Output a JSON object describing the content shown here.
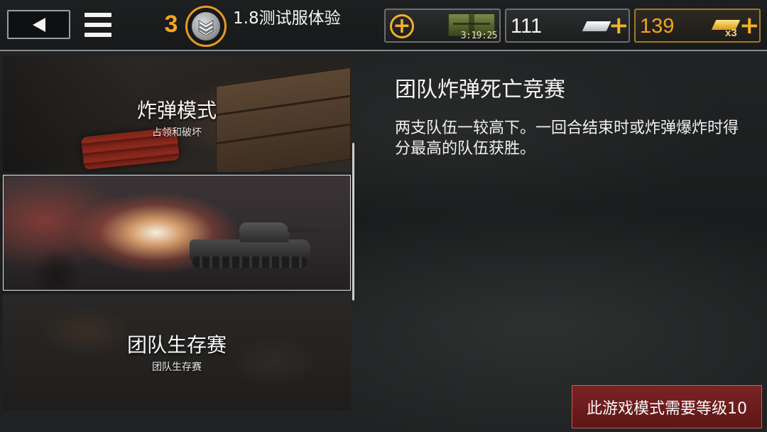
{
  "header": {
    "rank_level": "3",
    "server_label": "1.8测试服体验",
    "crate_timer": "3:19:25",
    "silver_amount": "111",
    "gold_amount": "139",
    "gold_multiplier": "x3",
    "accent_color": "#f0b12c"
  },
  "modes": [
    {
      "title": "炸弹模式",
      "subtitle": "占领和破坏",
      "selected": false
    },
    {
      "title": "",
      "subtitle": "",
      "selected": true
    },
    {
      "title": "团队生存赛",
      "subtitle": "团队生存赛",
      "selected": false
    }
  ],
  "detail": {
    "title": "团队炸弹死亡竞赛",
    "description": "两支队伍一较高下。一回合结束时或炸弹爆炸时得分最高的队伍获胜。",
    "requirement": "此游戏模式需要等级10",
    "requirement_color": "#7b2323"
  },
  "icons": [
    "back-arrow-icon",
    "hamburger-menu-icon",
    "rank-chevron-icon",
    "add-circle-icon",
    "ammo-crate-icon",
    "silver-bar-icon",
    "gold-bar-icon",
    "plus-icon"
  ]
}
